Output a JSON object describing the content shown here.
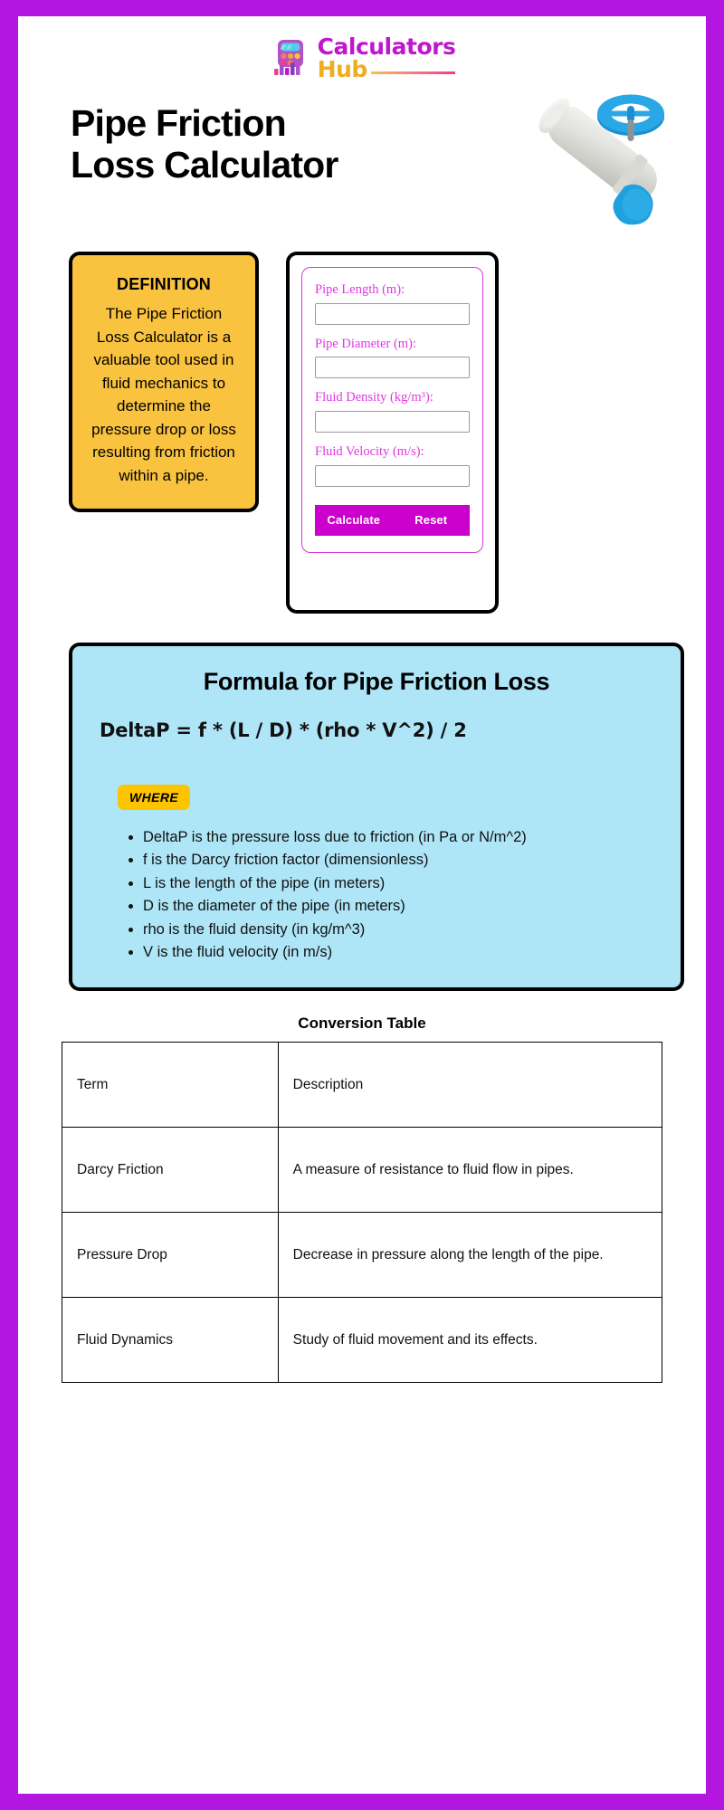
{
  "brand": {
    "logo_icon": "calculator-bars-logo-icon",
    "name_top": "Calculators",
    "name_bottom": "Hub",
    "color_top": "#C016CF",
    "color_bottom": "#F0AD1E"
  },
  "hero": {
    "title_line1": "Pipe Friction",
    "title_line2": "Loss Calculator",
    "illustration": "pipe-valve-handwheel-icon"
  },
  "definition": {
    "heading": "DEFINITION",
    "body": "The Pipe Friction Loss Calculator is a valuable tool used in fluid mechanics to determine the pressure drop or loss resulting from friction within a pipe.",
    "background": "#F9C23F"
  },
  "calculator": {
    "fields": [
      {
        "label": "Pipe Length (m):",
        "value": "",
        "placeholder": ""
      },
      {
        "label": "Pipe Diameter (m):",
        "value": "",
        "placeholder": ""
      },
      {
        "label": "Fluid Density (kg/m³):",
        "value": "",
        "placeholder": ""
      },
      {
        "label": "Fluid Velocity (m/s):",
        "value": "",
        "placeholder": ""
      }
    ],
    "calculate_label": "Calculate",
    "reset_label": "Reset",
    "accent": "#CC00CC",
    "label_color": "#E236E2"
  },
  "formula": {
    "title": "Formula for Pipe Friction Loss",
    "expression": "DeltaP = f * (L / D) * (rho * V^2) / 2",
    "where_badge": "WHERE",
    "background": "#AEE5F7",
    "items": [
      "DeltaP is the pressure loss due to friction (in Pa or N/m^2)",
      "f is the Darcy friction factor (dimensionless)",
      "L is the length of the pipe (in meters)",
      "D is the diameter of the pipe (in meters)",
      "rho is the fluid density (in kg/m^3)",
      "V is the fluid velocity (in m/s)"
    ]
  },
  "conversion_table": {
    "title": "Conversion Table",
    "headers": [
      "Term",
      "Description"
    ],
    "rows": [
      [
        "Darcy Friction",
        "A measure of resistance to fluid flow in pipes."
      ],
      [
        "Pressure Drop",
        "Decrease in pressure along the length of the pipe."
      ],
      [
        "Fluid Dynamics",
        "Study of fluid movement and its effects."
      ]
    ]
  },
  "frame_color": "#B316E0"
}
